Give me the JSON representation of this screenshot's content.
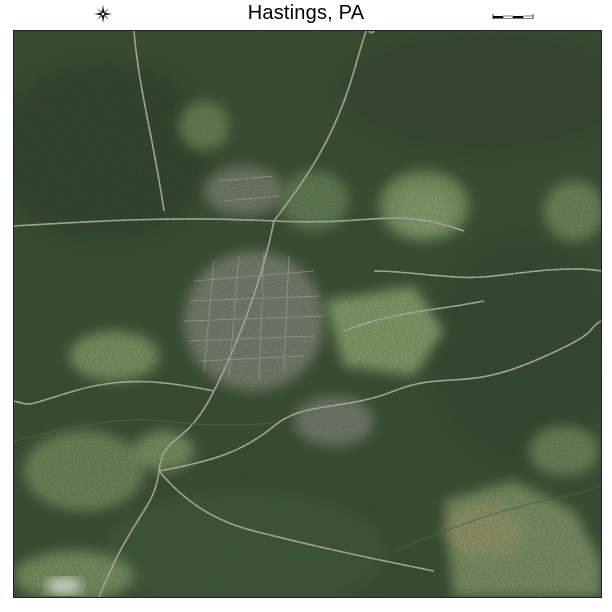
{
  "map": {
    "title": "Hastings, PA",
    "compass_icon": "compass-rose-icon",
    "scale_icon": "scale-bar-icon",
    "imagery_type": "aerial photograph",
    "palette": {
      "forest_dark": "#2b3d29",
      "forest_mid": "#3f5a3a",
      "field_light": "#7d9a63",
      "field_pale": "#a7b88b",
      "town": "#8b8c82",
      "road": "#c9c9bf"
    }
  }
}
